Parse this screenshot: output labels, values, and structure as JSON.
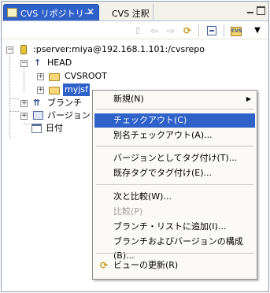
{
  "tabs": [
    {
      "label": "CVS リポジトリー",
      "close": "✕"
    },
    {
      "label": "CVS 注釈"
    }
  ],
  "toolbar": {
    "menu_glyph": "▼",
    "add_text": "CVS"
  },
  "tree": {
    "repository": ":pserver:miya@192.168.1.101:/cvsrepo",
    "head": "HEAD",
    "cvsroot": "CVSROOT",
    "module": "myjsf",
    "branches": "ブランチ",
    "versions": "バージョン",
    "dates": "日付"
  },
  "context_menu": {
    "new": "新規(N)",
    "checkout": "チェックアウト(C)",
    "checkout_as": "別名チェックアウト(A)...",
    "tag_as_version": "バージョンとしてタグ付け(T)...",
    "tag_with_existing": "既存タグでタグ付け(E)...",
    "compare_with": "次と比較(W)...",
    "compare": "比較(P)",
    "add_to_branch_list": "ブランチ・リストに追加(I)...",
    "configure_branches": "ブランチおよびバージョンの構成(B)...",
    "refresh_view": "ビューの更新(R)"
  }
}
